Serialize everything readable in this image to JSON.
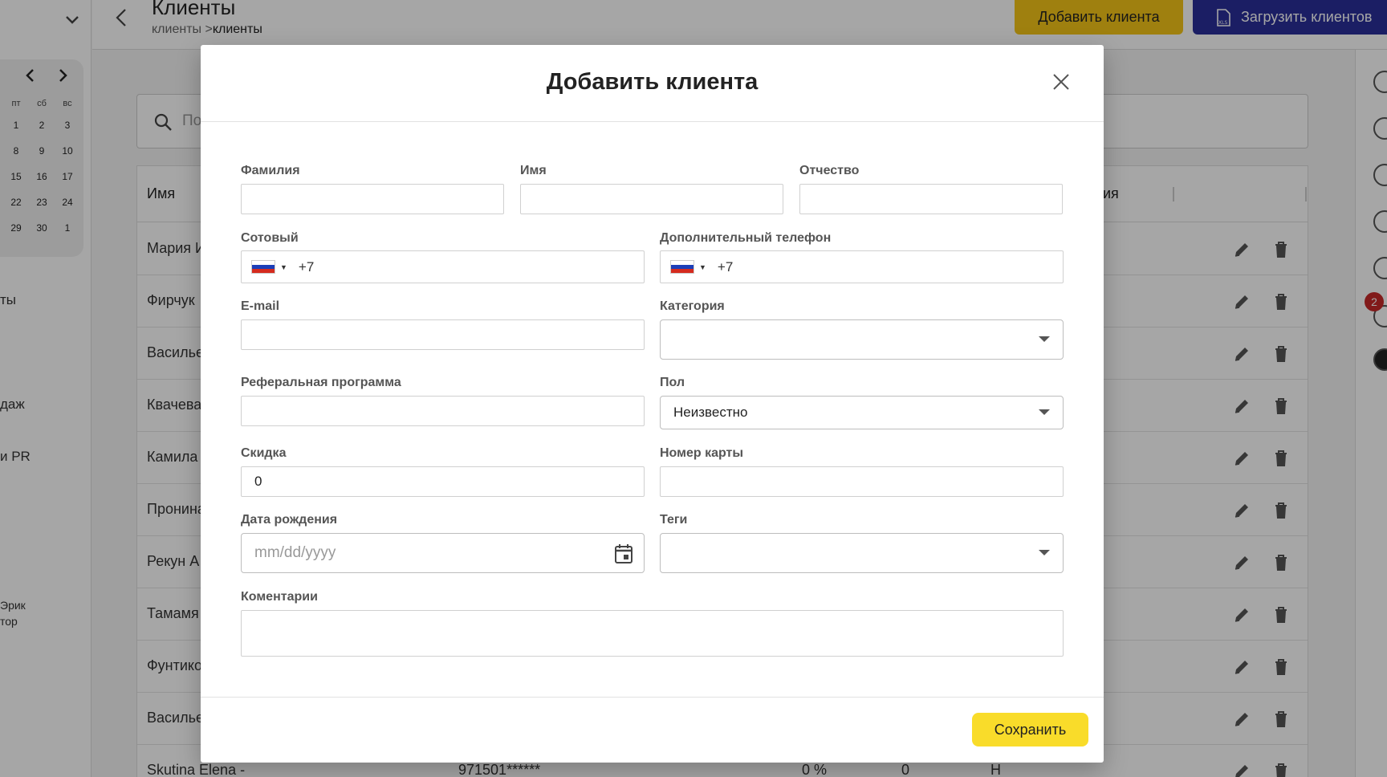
{
  "page": {
    "title": "Клиенты",
    "breadcrumb_root": "клиенты >",
    "breadcrumb_current": "клиенты",
    "add_client_button": "Добавить клиента",
    "upload_clients_button": "Загрузить клиентов",
    "search_placeholder": "По"
  },
  "sidebar": {
    "calendar_days_header": [
      "пт",
      "сб",
      "вс"
    ],
    "calendar_weeks": [
      [
        "1",
        "2",
        "3"
      ],
      [
        "8",
        "9",
        "10"
      ],
      [
        "15",
        "16",
        "17"
      ],
      [
        "22",
        "23",
        "24"
      ],
      [
        "29",
        "30",
        "1"
      ]
    ],
    "partial_items": [
      "ты",
      "даж",
      "и PR"
    ],
    "user_name_partial": "Эрик",
    "user_role_partial": "тор"
  },
  "table": {
    "header_name": "Имя",
    "header_right_partial": "ия",
    "rows": [
      {
        "name": "Мария И"
      },
      {
        "name": "Фирчук"
      },
      {
        "name": "Василье"
      },
      {
        "name": "Квачева"
      },
      {
        "name": "Камила"
      },
      {
        "name": "Пронина"
      },
      {
        "name": "Рекун А"
      },
      {
        "name": "Тамамя"
      },
      {
        "name": "Фунтико"
      },
      {
        "name": "Василье"
      },
      {
        "name": "Skutina Elena -",
        "phone": "971501******",
        "discount": "0 %",
        "count": "0",
        "extra": "Н"
      }
    ]
  },
  "right_rail": {
    "badge_count": "2"
  },
  "modal": {
    "title": "Добавить клиента",
    "fields": {
      "last_name_label": "Фамилия",
      "first_name_label": "Имя",
      "patronymic_label": "Отчество",
      "mobile_label": "Сотовый",
      "mobile_code": "+7",
      "extra_phone_label": "Дополнительный телефон",
      "extra_phone_code": "+7",
      "email_label": "E-mail",
      "category_label": "Категория",
      "category_value": "",
      "referral_label": "Реферальная программа",
      "gender_label": "Пол",
      "gender_value": "Неизвестно",
      "discount_label": "Скидка",
      "discount_value": "0",
      "card_number_label": "Номер карты",
      "birthdate_label": "Дата рождения",
      "birthdate_placeholder": "mm/dd/yyyy",
      "tags_label": "Теги",
      "comments_label": "Коментарии"
    },
    "save_button": "Сохранить"
  },
  "colors": {
    "accent_yellow": "#f9dc2a",
    "accent_blue": "#2a2f9a",
    "badge_red": "#c62828"
  }
}
